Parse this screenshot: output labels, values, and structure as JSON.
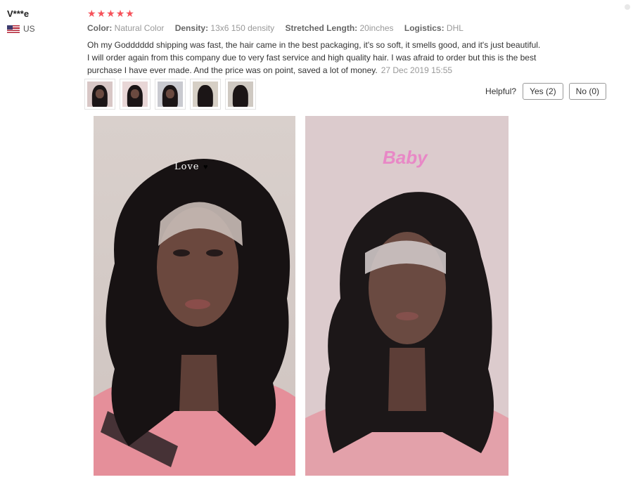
{
  "author": {
    "name": "V***e",
    "country": "US",
    "flag_icon": "us-flag-icon"
  },
  "rating": {
    "stars": 5,
    "max": 5,
    "color": "#f6525a"
  },
  "attributes": [
    {
      "key": "Color:",
      "value": "Natural Color"
    },
    {
      "key": "Density:",
      "value": "13x6 150 density"
    },
    {
      "key": "Stretched Length:",
      "value": "20inches"
    },
    {
      "key": "Logistics:",
      "value": "DHL"
    }
  ],
  "review": {
    "text": "Oh my Godddddd shipping was fast, the hair came in the best packaging, it's so soft, it smells good, and it's just beautiful. I will order again from this company due to very fast service and high quality hair. I was afraid to order but this is the best purchase I have ever made. And the price was on point, saved a lot of money.",
    "date": "27 Dec 2019 15:55"
  },
  "thumbnails": [
    "photo-1",
    "photo-2",
    "photo-3",
    "photo-4",
    "photo-5"
  ],
  "helpful": {
    "label": "Helpful?",
    "yes": "Yes (2)",
    "no": "No (0)"
  },
  "photos": [
    {
      "sticker": "Love"
    },
    {
      "sticker": "Baby"
    }
  ]
}
